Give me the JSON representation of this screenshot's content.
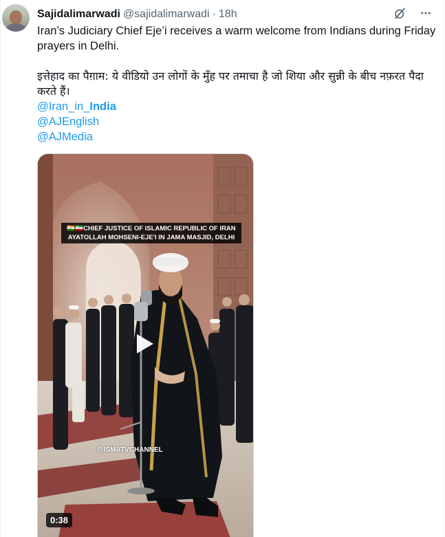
{
  "author": {
    "display_name": "Sajidalimarwadi",
    "handle": "@sajidalimarwadi",
    "separator": "·",
    "time": "18h"
  },
  "icons": {
    "grok": "grok-icon",
    "more": "more-icon",
    "play": "play-icon"
  },
  "tweet": {
    "text_en": "Iran’s Judiciary Chief Eje’i receives a warm welcome from Indians during Friday prayers in Delhi.",
    "text_hi": "इत्तेहाद का पैग़ाम: ये वीडियो उन लोगों के मुँह पर तमाचा है जो शिया और सुन्नी के बीच नफ़रत पैदा करते हैं।",
    "mentions": [
      {
        "prefix": "@Iran_in_",
        "bold": "India"
      },
      {
        "prefix": "@AJEnglish",
        "bold": ""
      },
      {
        "prefix": "@AJMedia",
        "bold": ""
      }
    ]
  },
  "media": {
    "caption_line1": "🇮🇳🇮🇷CHIEF JUSTICE OF ISLAMIC REPUBLIC OF IRAN",
    "caption_line2": "AYATOLLAH MOHSENI-EJE'I IN JAMA MASJID, DELHI",
    "watermark": "@ISMATVCHANNEL",
    "duration": "0:38"
  },
  "colors": {
    "link": "#1d9bf0",
    "text": "#0f1419",
    "secondary": "#536471"
  }
}
